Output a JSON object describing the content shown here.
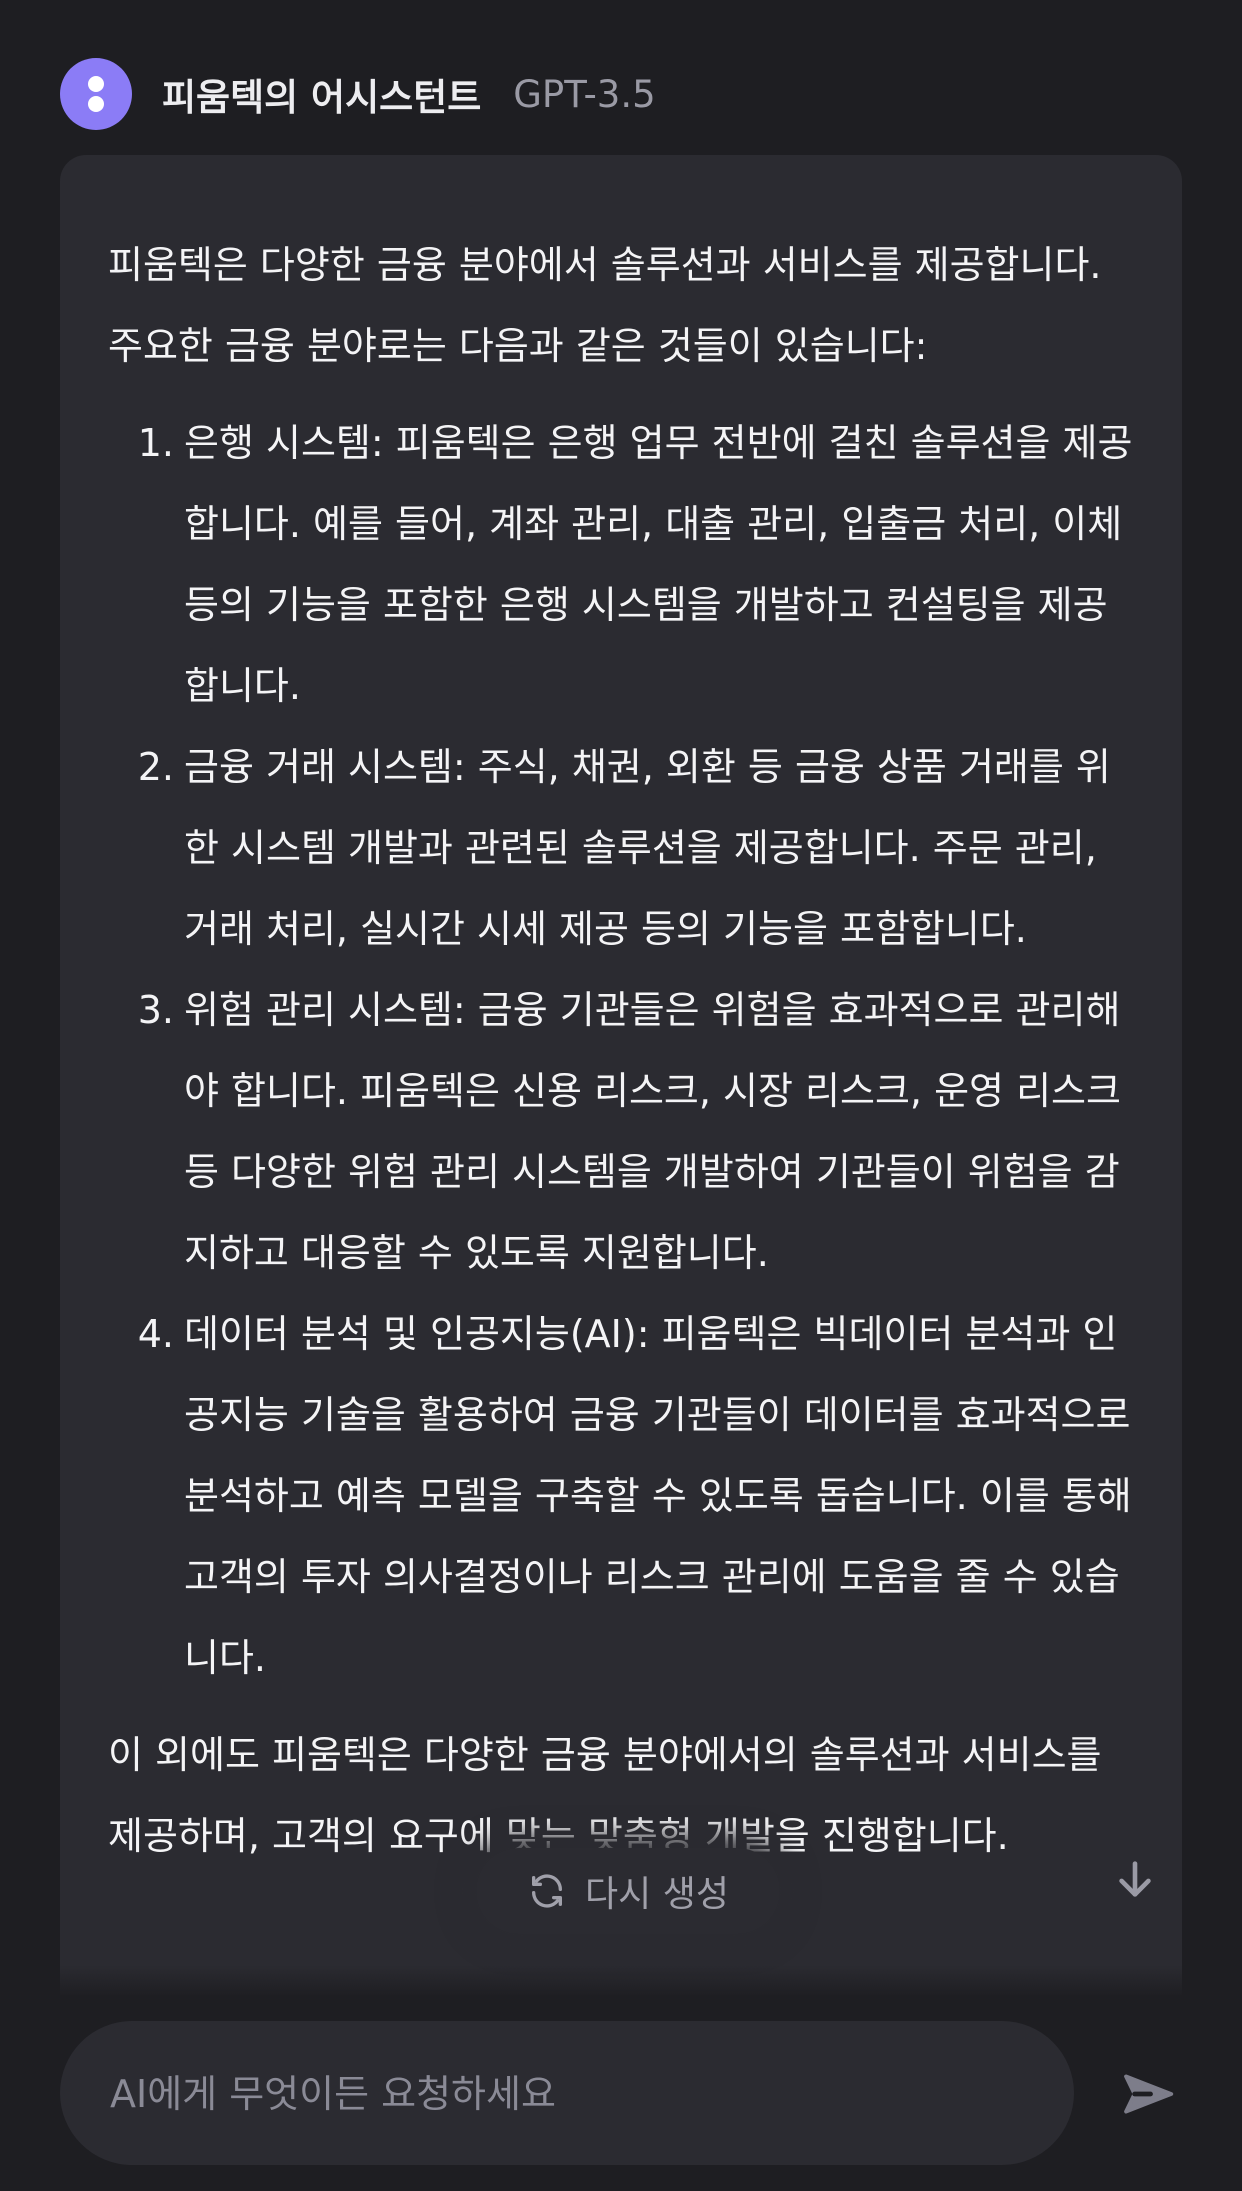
{
  "header": {
    "assistant_name": "피움텍의 어시스턴트",
    "model": "GPT-3.5"
  },
  "message": {
    "intro": "피움텍은 다양한 금융 분야에서 솔루션과 서비스를 제공합니다. 주요한 금융 분야로는 다음과 같은 것들이 있습니다:",
    "items": [
      {
        "num": "1.",
        "text": "은행 시스템: 피움텍은 은행 업무 전반에 걸친 솔루션을 제공합니다. 예를 들어, 계좌 관리, 대출 관리, 입출금 처리, 이체 등의 기능을 포함한 은행 시스템을 개발하고 컨설팅을 제공합니다."
      },
      {
        "num": "2.",
        "text": "금융 거래 시스템: 주식, 채권, 외환 등 금융 상품 거래를 위한 시스템 개발과 관련된 솔루션을 제공합니다. 주문 관리, 거래 처리, 실시간 시세 제공 등의 기능을 포함합니다."
      },
      {
        "num": "3.",
        "text": "위험 관리 시스템: 금융 기관들은 위험을 효과적으로 관리해야 합니다. 피움텍은 신용 리스크, 시장 리스크, 운영 리스크 등 다양한 위험 관리 시스템을 개발하여 기관들이 위험을 감지하고 대응할 수 있도록 지원합니다."
      },
      {
        "num": "4.",
        "text": "데이터 분석 및 인공지능(AI): 피움텍은 빅데이터 분석과 인공지능 기술을 활용하여 금융 기관들이 데이터를 효과적으로 분석하고 예측 모델을 구축할 수 있도록 돕습니다. 이를 통해 고객의 투자 의사결정이나 리스크 관리에 도움을 줄 수 있습니다."
      }
    ],
    "outro": "이 외에도 피움텍은 다양한 금융 분야에서의 솔루션과 서비스를 제공하며, 고객의 요구에 맞는 맞춤형 개발을 진행합니다."
  },
  "regenerate_label": "다시 생성",
  "input": {
    "placeholder": "AI에게 무엇이든 요청하세요"
  },
  "icons": {
    "regenerate": "refresh-icon",
    "scroll": "arrow-down-icon",
    "send": "send-icon"
  },
  "colors": {
    "background": "#1e1e22",
    "bubble": "#2b2b31",
    "avatar": "#8b7cf6",
    "muted_text": "#9a9aa5"
  }
}
